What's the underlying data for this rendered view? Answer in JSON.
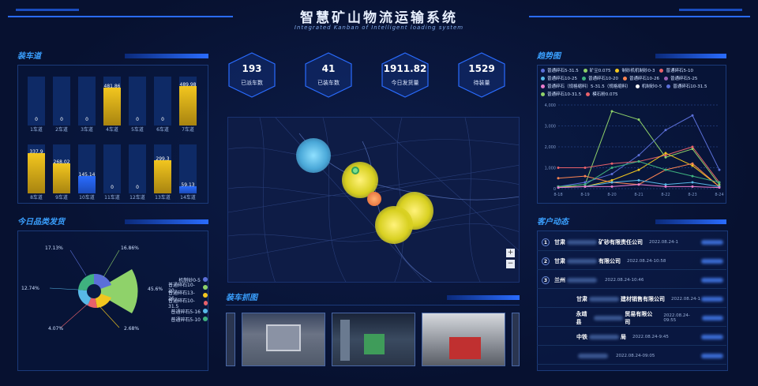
{
  "header": {
    "title": "智慧矿山物流运输系统",
    "subtitle": "Integrated Kanban of Intelligent loading system"
  },
  "sections": {
    "loading_lanes": "装车道",
    "today_products": "今日品类发货",
    "trend": "趋势图",
    "customers": "客户动态",
    "snapshots": "装车抓图"
  },
  "kpis": [
    {
      "value": "193",
      "label": "已派车数"
    },
    {
      "value": "41",
      "label": "已装车数"
    },
    {
      "value": "1911.82",
      "label": "今日发货量"
    },
    {
      "value": "1529",
      "label": "待装量"
    }
  ],
  "lanes_top": [
    {
      "label": "1车道",
      "value": "0",
      "fill": 0.0,
      "color": "#2a6cff"
    },
    {
      "label": "2车道",
      "value": "0",
      "fill": 0.0,
      "color": "#2a6cff"
    },
    {
      "label": "3车道",
      "value": "0",
      "fill": 0.0,
      "color": "#2a6cff"
    },
    {
      "label": "4车道",
      "value": "481.86",
      "fill": 0.78,
      "color": "#f2c61f"
    },
    {
      "label": "5车道",
      "value": "0",
      "fill": 0.0,
      "color": "#2a6cff"
    },
    {
      "label": "6车道",
      "value": "0",
      "fill": 0.0,
      "color": "#2a6cff"
    },
    {
      "label": "7车道",
      "value": "489.98",
      "fill": 0.8,
      "color": "#f2c61f"
    }
  ],
  "lanes_bottom": [
    {
      "label": "8车道",
      "value": "337.9",
      "fill": 0.82,
      "color": "#f2c61f"
    },
    {
      "label": "9车道",
      "value": "268.02",
      "fill": 0.62,
      "color": "#f2c61f"
    },
    {
      "label": "10车道",
      "value": "145.14",
      "fill": 0.35,
      "color": "#2a6cff"
    },
    {
      "label": "11车道",
      "value": "0",
      "fill": 0.0,
      "color": "#2a6cff"
    },
    {
      "label": "12车道",
      "value": "0",
      "fill": 0.0,
      "color": "#2a6cff"
    },
    {
      "label": "13车道",
      "value": "299.3",
      "fill": 0.68,
      "color": "#f2c61f"
    },
    {
      "label": "14车道",
      "value": "59.13",
      "fill": 0.14,
      "color": "#2a6cff"
    }
  ],
  "pie": {
    "labels": {
      "p1": "17.13%",
      "p2": "16.86%",
      "p3": "45.6%",
      "p4": "12.74%",
      "p5": "4.07%",
      "p6": "2.68%"
    },
    "legend": [
      {
        "name": "机制砂0-5",
        "color": "#5b6fd8"
      },
      {
        "name": "普通碎石10-20",
        "color": "#8fd26a"
      },
      {
        "name": "普通碎石13-26",
        "color": "#f2c61f"
      },
      {
        "name": "普通碎石10-31.5",
        "color": "#e8616a"
      },
      {
        "name": "普通碎石5-16",
        "color": "#58b9e8"
      },
      {
        "name": "普通碎石5-10",
        "color": "#3fb27f"
      }
    ]
  },
  "trend": {
    "legend": [
      {
        "name": "普通碎石5-31.5",
        "color": "#5b6fd8"
      },
      {
        "name": "矿尘0.075",
        "color": "#8fd26a"
      },
      {
        "name": "制砂机机制砂0-3",
        "color": "#f2c61f"
      },
      {
        "name": "普通碎石5-10",
        "color": "#e8616a"
      },
      {
        "name": "普通碎石10-25",
        "color": "#58b9e8"
      },
      {
        "name": "普通碎石10-20",
        "color": "#3fb27f"
      },
      {
        "name": "普通碎石10-26",
        "color": "#fc8452"
      },
      {
        "name": "普通碎石5-25",
        "color": "#9a60b4"
      },
      {
        "name": "普通碎石（规格缩料）5-31.5（规格缩料）",
        "color": "#ea7ccc"
      },
      {
        "name": "机制砂0-5",
        "color": "#ffffff"
      },
      {
        "name": "普通碎石10-31.5",
        "color": "#5b6fd8"
      },
      {
        "name": "普通碎石10-31.5",
        "color": "#8fd26a"
      },
      {
        "name": "模石粉0.075",
        "color": "#e8616a"
      }
    ],
    "yticks": [
      "4,000",
      "3,000",
      "2,000",
      "1,000",
      "0"
    ],
    "xticks": [
      "8-18",
      "8-19",
      "8-20",
      "8-21",
      "8-22",
      "8-23",
      "8-24"
    ]
  },
  "customers": [
    {
      "num": "1",
      "name": "甘肃",
      "suffix": "矿砂有限责任公司",
      "time": "2022.08.24-1"
    },
    {
      "num": "2",
      "name": "甘肃",
      "suffix": "有限公司",
      "time": "2022.08.24-10:58"
    },
    {
      "num": "3",
      "name": "兰州",
      "suffix": "",
      "time": "2022.08.24-10:46"
    },
    {
      "num": "",
      "name": "甘肃",
      "suffix": "建材销售有限公司",
      "time": "2022.08.24-1"
    },
    {
      "num": "",
      "name": "永靖县",
      "suffix": "贸易有限公司",
      "time": "2022.08.24-09:55"
    },
    {
      "num": "",
      "name": "中铁",
      "suffix": "局",
      "time": "2022.08.24-9:45"
    },
    {
      "num": "",
      "name": "",
      "suffix": "",
      "time": "2022.08.24-09:05"
    }
  ],
  "colors": {
    "accent": "#2a6cff",
    "yellow": "#f2c61f",
    "bg": "#071130"
  }
}
